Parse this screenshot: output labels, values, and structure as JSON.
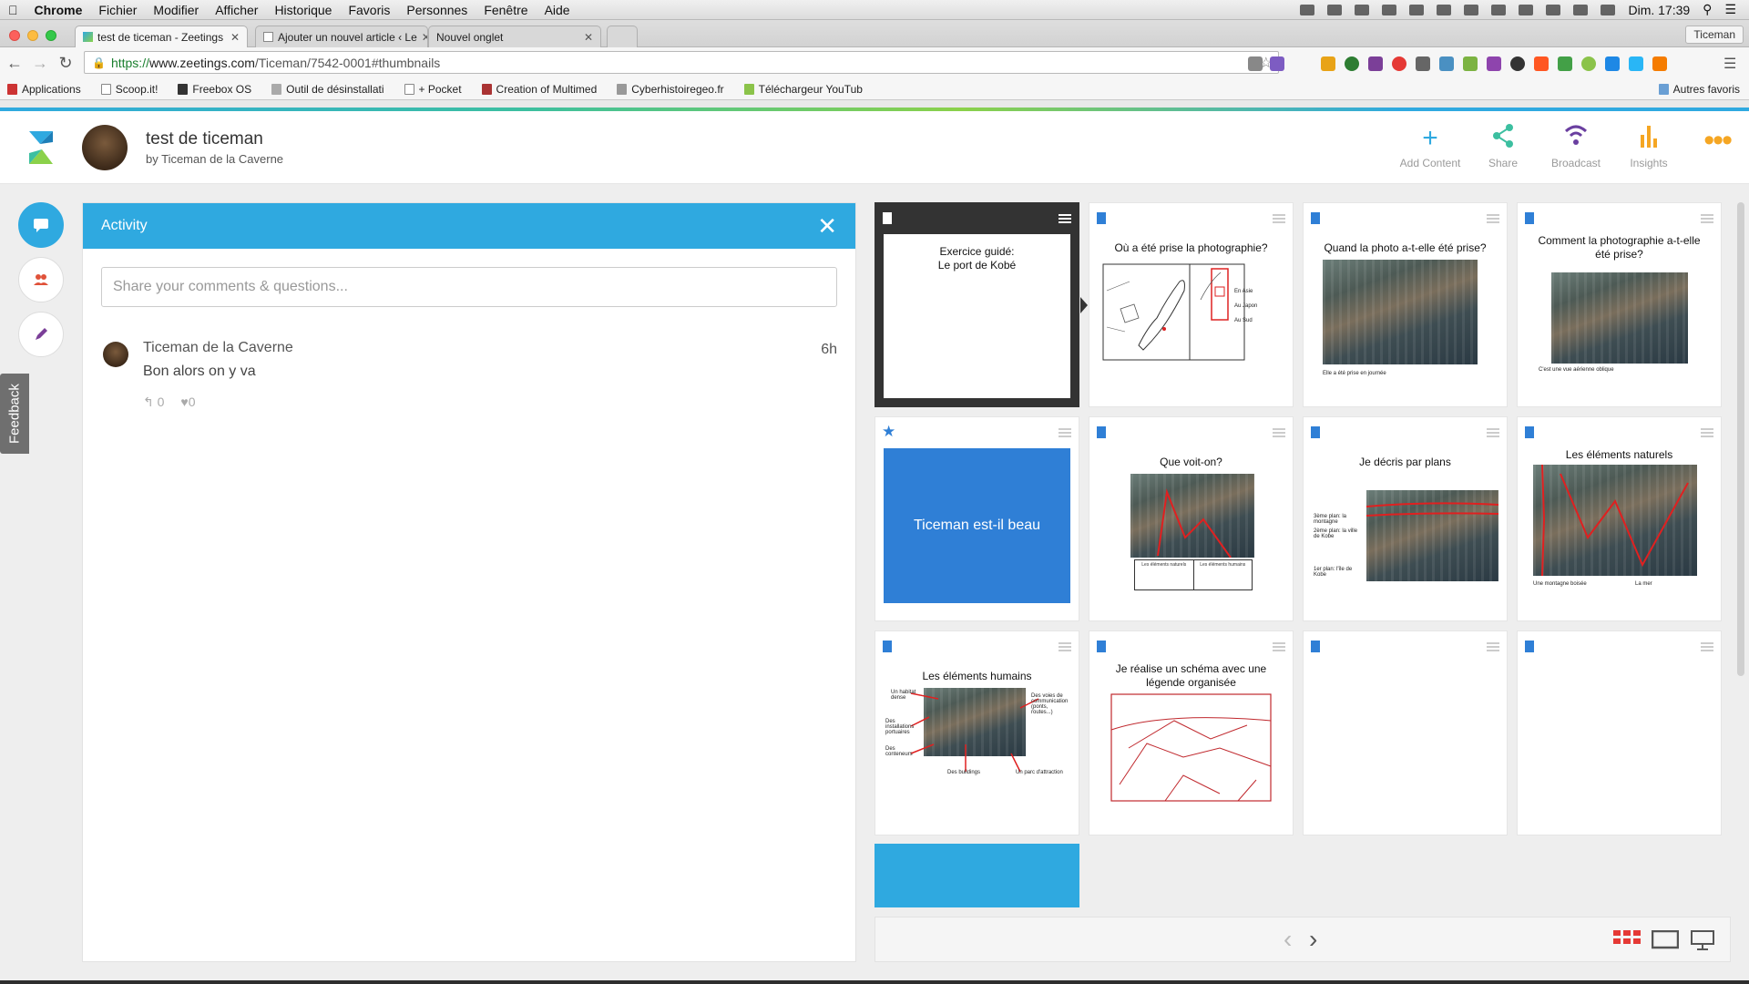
{
  "menubar": {
    "app": "Chrome",
    "items": [
      "Fichier",
      "Modifier",
      "Afficher",
      "Historique",
      "Favoris",
      "Personnes",
      "Fenêtre",
      "Aide"
    ],
    "clock": "Dim. 17:39"
  },
  "browser": {
    "tabs": [
      {
        "title": "test de ticeman - Zeetings",
        "active": true
      },
      {
        "title": "Ajouter un nouvel article ‹ Le",
        "active": false
      },
      {
        "title": "Nouvel onglet",
        "active": false
      }
    ],
    "profile": "Ticeman",
    "url_scheme": "https://",
    "url_host": "www.zeetings.com",
    "url_path": "/Ticeman/7542-0001#thumbnails",
    "bookmarks": [
      "Applications",
      "Scoop.it!",
      "Freebox OS",
      "Outil de désinstallati",
      "+ Pocket",
      "Creation of Multimed",
      "Cyberhistoiregeo.fr",
      "Téléchargeur YouTub"
    ],
    "other_bookmarks": "Autres favoris"
  },
  "header": {
    "title": "test de ticeman",
    "byline": "by Ticeman de la Caverne",
    "actions": [
      {
        "label": "Add Content",
        "icon": "plus-icon",
        "color": "#2fa9e0"
      },
      {
        "label": "Share",
        "icon": "share-icon",
        "color": "#3cbfa0"
      },
      {
        "label": "Broadcast",
        "icon": "broadcast-icon",
        "color": "#6a3fa0"
      },
      {
        "label": "Insights",
        "icon": "insights-icon",
        "color": "#f5a623"
      }
    ]
  },
  "sidebar": {
    "feedback": "Feedback"
  },
  "activity": {
    "title": "Activity",
    "placeholder": "Share your comments & questions...",
    "comments": [
      {
        "author": "Ticeman de la Caverne",
        "text": "Bon alors on y va",
        "time": "6h",
        "replies": "0",
        "likes": "0"
      }
    ]
  },
  "slides": [
    {
      "title": "Exercice guidé:\nLe port de Kobé",
      "selected": true
    },
    {
      "title": "Où a été prise la photographie?",
      "labels": [
        "En Asie",
        "Au Japon",
        "Au Sud"
      ]
    },
    {
      "title": "Quand la photo a-t-elle été prise?",
      "caption": "Elle a été prise en journée"
    },
    {
      "title": "Comment la photographie a-t-elle été prise?",
      "caption": "C'est une vue aérienne oblique"
    },
    {
      "title": "Ticeman est-il beau",
      "starred": true
    },
    {
      "title": "Que voit-on?",
      "table_headers": [
        "Les éléments naturels",
        "Les éléments humains"
      ]
    },
    {
      "title": "Je décris par plans",
      "labels": [
        "3ème plan: la montagne",
        "2ème plan: la ville de Kobe",
        "1er plan: l'île de Kobe"
      ]
    },
    {
      "title": "Les éléments naturels",
      "labels": [
        "Une montagne boisée",
        "La mer"
      ]
    },
    {
      "title": "Les éléments humains",
      "labels": [
        "Un habitat dense",
        "Des installations portuaires",
        "Des conteneurs",
        "Des buildings",
        "Un parc d'attraction",
        "Des voies de communication (ponts, routes...)"
      ]
    },
    {
      "title": "Je réalise un schéma avec une légende organisée"
    },
    {
      "title": ""
    },
    {
      "title": ""
    }
  ]
}
